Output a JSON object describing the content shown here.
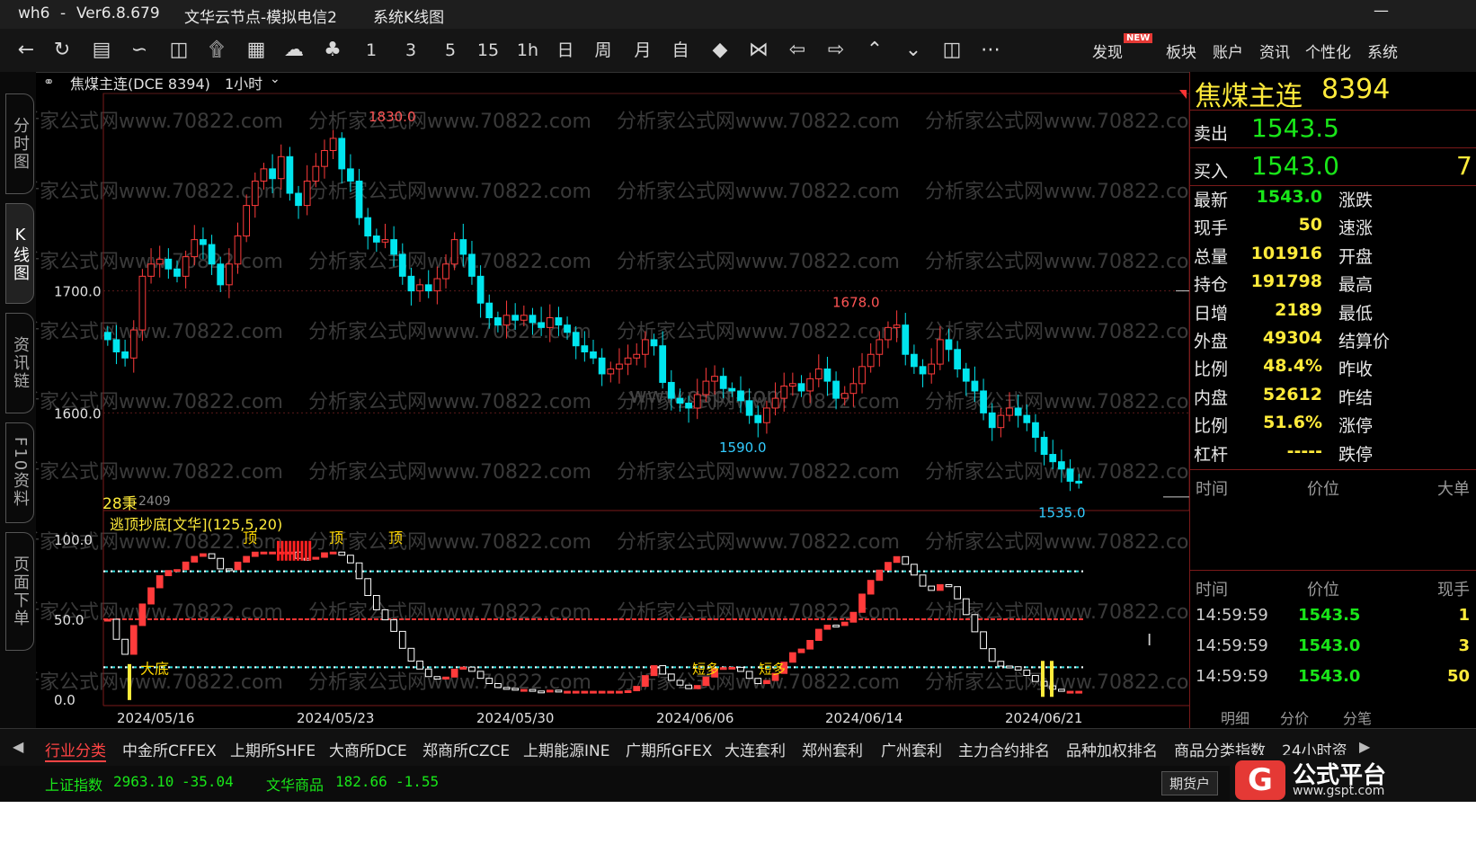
{
  "titlebar": {
    "app": "wh6",
    "sep": "-",
    "version": "Ver6.8.679",
    "server": "文华云节点-模拟电信2",
    "view": "系统K线图",
    "minimize": "—"
  },
  "toolbar": {
    "icons": [
      "back-icon",
      "refresh-icon",
      "list-icon",
      "line-chart-icon",
      "candle-icon",
      "lightning-icon",
      "cross-frame-icon",
      "cloud-icon",
      "bell-icon"
    ],
    "periods": [
      "1",
      "3",
      "5",
      "15",
      "1h",
      "日",
      "周",
      "月",
      "自"
    ],
    "nav_icons": [
      "shrink-icon",
      "expand-icon",
      "left-arrow-icon",
      "right-arrow-icon",
      "up-arrow-icon",
      "down-arrow-icon",
      "split-icon",
      "more-icon"
    ],
    "right": {
      "discover": "发现",
      "new_badge": "NEW",
      "sector": "板块",
      "account": "账户",
      "news": "资讯",
      "personalize": "个性化",
      "system": "系统"
    }
  },
  "leftnav": [
    "分时图",
    "K线图",
    "资讯链",
    "F10资料",
    "页面下单"
  ],
  "chart_header": {
    "contract": "焦煤主连(DCE 8394)",
    "period": "1小时"
  },
  "chart_data": {
    "type": "candlestick",
    "title": "焦煤主连(DCE 8394)",
    "period": "1小时",
    "y_ticks": [
      "1700.0",
      "1600.0"
    ],
    "x_ticks": [
      "2024/05/16",
      "2024/05/23",
      "2024/05/30",
      "2024/06/06",
      "2024/06/14",
      "2024/06/21"
    ],
    "annotations": [
      {
        "label": "1830.0",
        "color": "#ff5555"
      },
      {
        "label": "1678.0",
        "color": "#ff5555"
      },
      {
        "label": "1590.0",
        "color": "#33ccff"
      },
      {
        "label": "1535.0",
        "color": "#33ccff"
      }
    ],
    "closes": [
      1660,
      1650,
      1645,
      1668,
      1712,
      1722,
      1726,
      1718,
      1712,
      1728,
      1742,
      1738,
      1722,
      1705,
      1722,
      1745,
      1770,
      1790,
      1800,
      1792,
      1810,
      1780,
      1770,
      1790,
      1802,
      1815,
      1825,
      1800,
      1790,
      1760,
      1745,
      1740,
      1742,
      1730,
      1712,
      1700,
      1705,
      1700,
      1710,
      1722,
      1742,
      1730,
      1712,
      1690,
      1678,
      1672,
      1680,
      1676,
      1680,
      1674,
      1670,
      1678,
      1672,
      1666,
      1655,
      1650,
      1645,
      1632,
      1636,
      1640,
      1645,
      1648,
      1660,
      1655,
      1625,
      1612,
      1608,
      1604,
      1615,
      1626,
      1630,
      1620,
      1618,
      1610,
      1598,
      1592,
      1604,
      1612,
      1622,
      1624,
      1618,
      1628,
      1636,
      1626,
      1612,
      1616,
      1624,
      1638,
      1648,
      1660,
      1670,
      1672,
      1648,
      1638,
      1632,
      1640,
      1660,
      1652,
      1636,
      1626,
      1618,
      1600,
      1588,
      1598,
      1604,
      1598,
      1592,
      1580,
      1566,
      1560,
      1554,
      1544,
      1543
    ],
    "band_high": [
      1830,
      1678
    ],
    "band_low": [
      1590,
      1535
    ]
  },
  "volume_label": {
    "value": "28秉",
    "contract": "2409"
  },
  "indicator": {
    "name": "逃顶抄底[文华](125,5,20)",
    "y_ticks": [
      "100.0",
      "50.0",
      "0.0"
    ],
    "tops": [
      "顶",
      "顶",
      "顶"
    ],
    "bottom": "大底",
    "short_longs": [
      "短多",
      "短多"
    ]
  },
  "quote": {
    "name": "焦煤主连",
    "code": "8394",
    "sell_label": "卖出",
    "sell_price": "1543.5",
    "buy_label": "买入",
    "buy_price": "1543.0",
    "buy_qty": "7",
    "rows": [
      {
        "l": "最新",
        "v": "1543.0",
        "r": "涨跌",
        "green": true
      },
      {
        "l": "现手",
        "v": "50",
        "r": "速涨"
      },
      {
        "l": "总量",
        "v": "101916",
        "r": "开盘"
      },
      {
        "l": "持仓",
        "v": "191798",
        "r": "最高"
      },
      {
        "l": "日增",
        "v": "2189",
        "r": "最低"
      },
      {
        "l": "外盘",
        "v": "49304",
        "r": "结算价"
      },
      {
        "l": "比例",
        "v": "48.4%",
        "r": "昨收"
      },
      {
        "l": "内盘",
        "v": "52612",
        "r": "昨结"
      },
      {
        "l": "比例",
        "v": "51.6%",
        "r": "涨停"
      },
      {
        "l": "杠杆",
        "v": "-----",
        "r": "跌停"
      }
    ],
    "big_order_header": {
      "time": "时间",
      "price": "价位",
      "big": "大单"
    },
    "tick_header": {
      "time": "时间",
      "price": "价位",
      "vol": "现手"
    },
    "ticks": [
      {
        "time": "14:59:59",
        "price": "1543.5",
        "vol": "1"
      },
      {
        "time": "14:59:59",
        "price": "1543.0",
        "vol": "3"
      },
      {
        "time": "14:59:59",
        "price": "1543.0",
        "vol": "50"
      }
    ],
    "side_tabs": [
      "明细",
      "分价",
      "分笔"
    ]
  },
  "bottom_tabs": [
    "行业分类",
    "中金所CFFEX",
    "上期所SHFE",
    "大商所DCE",
    "郑商所CZCE",
    "上期能源INE",
    "广期所GFEX",
    "大连套利",
    "郑州套利",
    "广州套利",
    "主力合约排名",
    "品种加权排名",
    "商品分类指数",
    "24小时资"
  ],
  "status": {
    "idx1_name": "上证指数",
    "idx1_val": "2963.10",
    "idx1_chg": "-35.04",
    "idx2_name": "文华商品",
    "idx2_val": "182.66",
    "idx2_chg": "-1.55",
    "account": "期货户"
  },
  "watermark": {
    "text": "分析家公式网www.70822.com",
    "center": "www.gspt.com"
  },
  "logo": {
    "name": "公式平台",
    "url": "www.gspt.com"
  },
  "colors": {
    "up": "#ff3b3b",
    "down": "#00e5ee",
    "bg": "#000000",
    "accent": "#ffeb3b"
  }
}
